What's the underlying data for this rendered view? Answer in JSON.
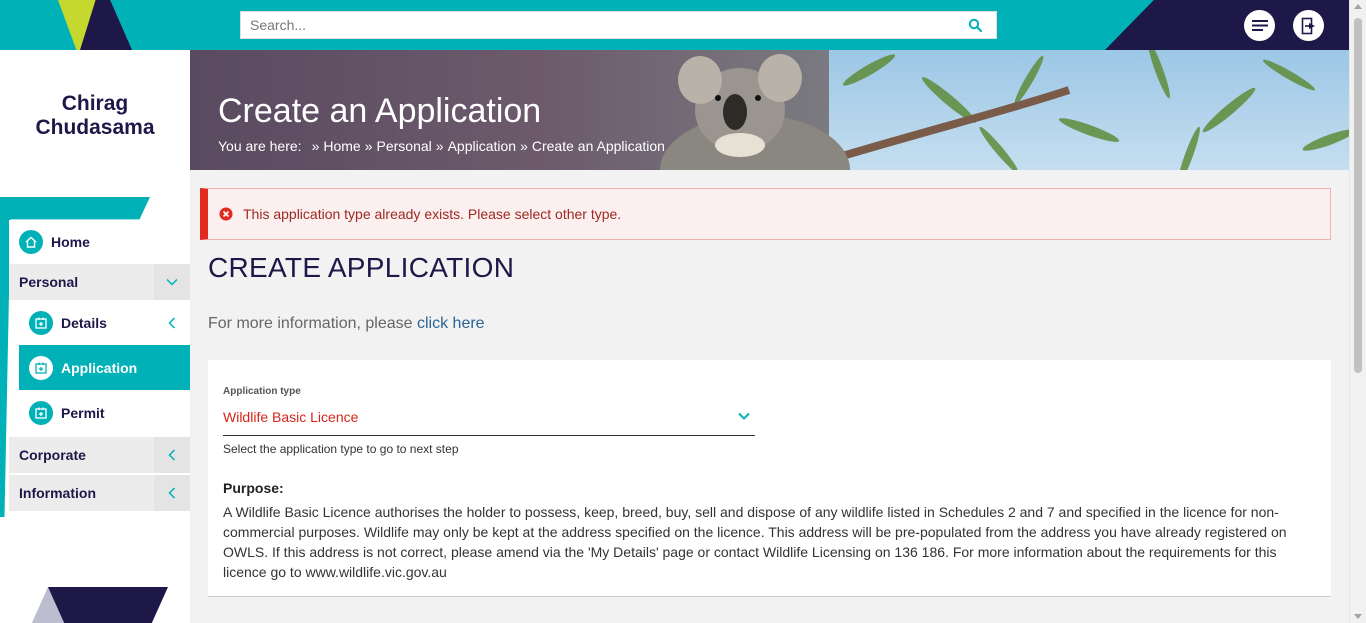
{
  "search": {
    "placeholder": "Search..."
  },
  "header": {
    "menu_icon": "menu-icon",
    "logout_icon": "logout-icon"
  },
  "user": {
    "name": "Chirag Chudasama"
  },
  "sidebar": {
    "home": {
      "label": "Home",
      "icon": "home-icon"
    },
    "groups": [
      {
        "label": "Personal",
        "expanded": true
      },
      {
        "label": "Corporate",
        "expanded": false
      },
      {
        "label": "Information",
        "expanded": false
      }
    ],
    "personal_items": [
      {
        "label": "Details",
        "icon": "id-card-icon"
      },
      {
        "label": "Application",
        "icon": "id-card-icon",
        "active": true
      },
      {
        "label": "Permit",
        "icon": "id-card-icon"
      }
    ]
  },
  "hero": {
    "title": "Create an Application",
    "breadcrumb_prefix": "You are here:",
    "breadcrumb": [
      "Home",
      "Personal",
      "Application",
      "Create an Application"
    ]
  },
  "alert": {
    "text": "This application type already exists. Please select other type."
  },
  "main": {
    "heading": "CREATE APPLICATION",
    "more_info_text": "For more information, please",
    "more_info_link": "click here"
  },
  "form": {
    "type_label": "Application type",
    "type_value": "Wildlife Basic Licence",
    "helper": "Select the application type to go to next step",
    "purpose_title": "Purpose:",
    "purpose_text": "A Wildlife Basic Licence authorises the holder to possess, keep, breed, buy, sell and dispose of any wildlife listed in Schedules 2 and 7 and specified in the licence for non-commercial purposes. Wildlife may only be kept at the address specified on the licence. This address will be pre-populated from the address you have already registered on OWLS. If this address is not correct, please amend via the 'My Details' page or contact Wildlife Licensing on 136 186. For more information about the requirements for this licence go to www.wildlife.vic.gov.au"
  },
  "colors": {
    "teal": "#00b2b8",
    "navy": "#1d1848",
    "lime": "#c4d82e",
    "error": "#e22a1f"
  }
}
